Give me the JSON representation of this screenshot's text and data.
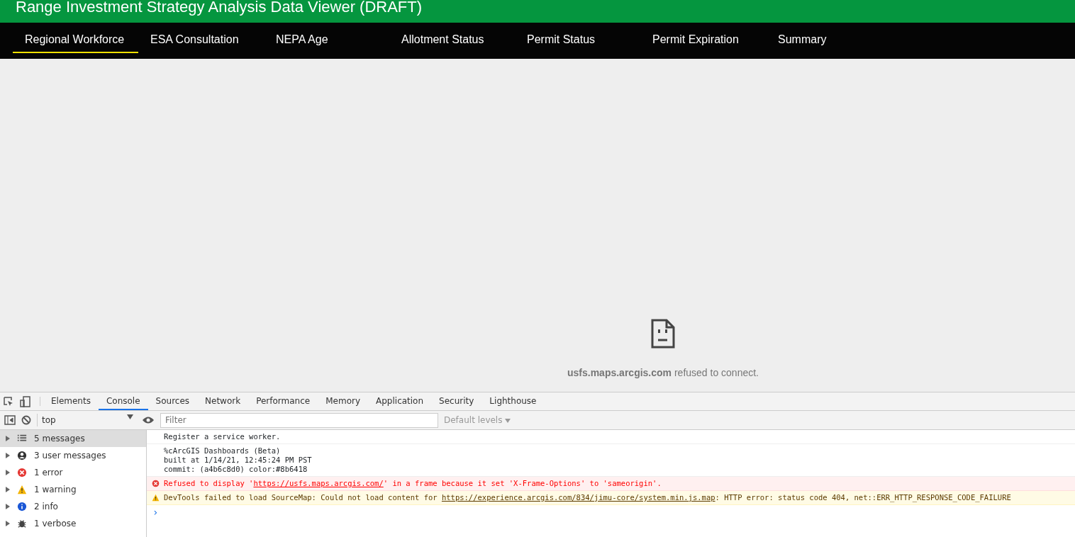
{
  "header": {
    "title": "Range Investment Strategy Analysis Data Viewer (DRAFT)"
  },
  "tabs": [
    {
      "label": "Regional Workforce",
      "selected": true
    },
    {
      "label": "ESA Consultation",
      "selected": false
    },
    {
      "label": "NEPA Age",
      "selected": false
    },
    {
      "label": "Allotment Status",
      "selected": false
    },
    {
      "label": "Permit Status",
      "selected": false
    },
    {
      "label": "Permit Expiration",
      "selected": false
    },
    {
      "label": "Summary",
      "selected": false
    }
  ],
  "frame_error": {
    "host": "usfs.maps.arcgis.com",
    "message": "refused to connect."
  },
  "devtools": {
    "tabs": [
      {
        "label": "Elements",
        "selected": false
      },
      {
        "label": "Console",
        "selected": true
      },
      {
        "label": "Sources",
        "selected": false
      },
      {
        "label": "Network",
        "selected": false
      },
      {
        "label": "Performance",
        "selected": false
      },
      {
        "label": "Memory",
        "selected": false
      },
      {
        "label": "Application",
        "selected": false
      },
      {
        "label": "Security",
        "selected": false
      },
      {
        "label": "Lighthouse",
        "selected": false
      }
    ],
    "context": "top",
    "filter": {
      "placeholder": "Filter"
    },
    "levels": "Default levels",
    "sidebar": [
      {
        "kind": "list",
        "label": "5 messages",
        "selected": true
      },
      {
        "kind": "user",
        "label": "3 user messages",
        "selected": false
      },
      {
        "kind": "error",
        "label": "1 error",
        "selected": false
      },
      {
        "kind": "warning",
        "label": "1 warning",
        "selected": false
      },
      {
        "kind": "info",
        "label": "2 info",
        "selected": false
      },
      {
        "kind": "verbose",
        "label": "1 verbose",
        "selected": false
      }
    ],
    "messages": [
      {
        "kind": "log",
        "lines": [
          [
            {
              "kind": "text",
              "text": "Register a service worker."
            }
          ]
        ]
      },
      {
        "kind": "log",
        "lines": [
          [
            {
              "kind": "text",
              "text": "%cArcGIS Dashboards (Beta)"
            }
          ],
          [
            {
              "kind": "text",
              "text": "built at 1/14/21, 12:45:24 PM PST"
            }
          ],
          [
            {
              "kind": "text",
              "text": "commit: (a4b6c8d0) color:#8b6418"
            }
          ]
        ]
      },
      {
        "kind": "error",
        "lines": [
          [
            {
              "kind": "text",
              "text": "Refused to display '"
            },
            {
              "kind": "link",
              "text": "https://usfs.maps.arcgis.com/"
            },
            {
              "kind": "text",
              "text": "' in a frame because it set 'X-Frame-Options' to 'sameorigin'."
            }
          ]
        ]
      },
      {
        "kind": "warning",
        "lines": [
          [
            {
              "kind": "text",
              "text": "DevTools failed to load SourceMap: Could not load content for "
            },
            {
              "kind": "link",
              "text": "https://experience.arcgis.com/834/jimu-core/system.min.js.map"
            },
            {
              "kind": "text",
              "text": ": HTTP error: status code 404, net::ERR_HTTP_RESPONSE_CODE_FAILURE"
            }
          ]
        ]
      }
    ],
    "prompt": "›"
  }
}
